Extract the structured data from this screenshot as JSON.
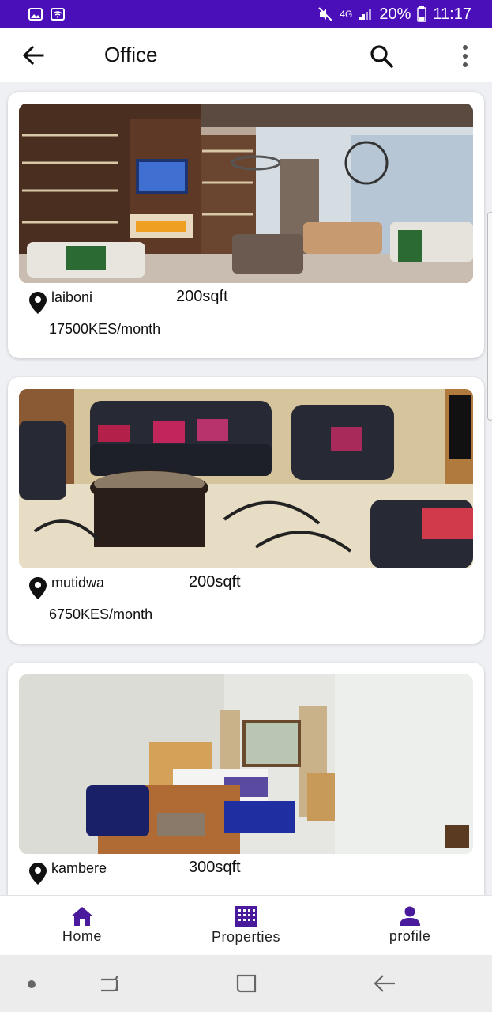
{
  "status_bar": {
    "network": "4G",
    "battery": "20%",
    "time": "11:17",
    "icons": [
      "image-icon",
      "wifi-icon",
      "mute-icon",
      "signal-icon",
      "battery-icon"
    ]
  },
  "app_bar": {
    "title": "Office",
    "icons": [
      "back-arrow-icon",
      "search-icon",
      "more-vert-icon"
    ]
  },
  "listings": [
    {
      "location": "laiboni",
      "size": "200sqft",
      "price": "17500KES/month",
      "image": "living-room-photo"
    },
    {
      "location": "mutidwa",
      "size": "200sqft",
      "price": "6750KES/month",
      "image": "lounge-photo"
    },
    {
      "location": "kambere",
      "size": "300sqft",
      "price": "",
      "image": "bedroom-photo"
    }
  ],
  "bottom_nav": {
    "items": [
      {
        "label": "Home",
        "icon": "home-icon"
      },
      {
        "label": "Properties",
        "icon": "building-icon"
      },
      {
        "label": "profile",
        "icon": "person-icon"
      }
    ],
    "accent": "#4a1a9c"
  },
  "colors": {
    "status_bar": "#4a0fb8",
    "background": "#eef0f4",
    "accent": "#4a1a9c"
  }
}
